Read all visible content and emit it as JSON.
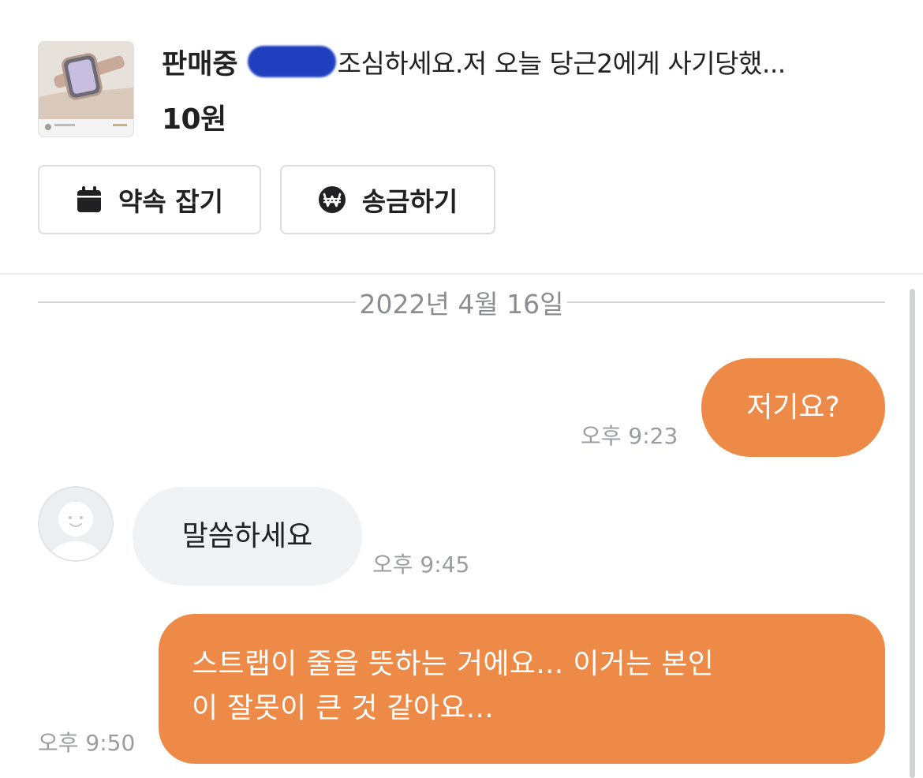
{
  "product": {
    "status": "판매중",
    "title": "조심하세요.저 오늘 당근2에게 사기당했...",
    "price": "10원",
    "thumbnail_icon": "watch-product-photo",
    "redaction_color": "#1f3fbf"
  },
  "actions": {
    "appointment": {
      "label": "약속 잡기",
      "icon": "calendar-icon"
    },
    "transfer": {
      "label": "송금하기",
      "icon": "won-coin-icon"
    }
  },
  "chat": {
    "date": "2022년 4월 16일",
    "messages": [
      {
        "direction": "outgoing",
        "text": "저기요?",
        "time": "오후 9:23"
      },
      {
        "direction": "incoming",
        "text": "말씀하세요",
        "time": "오후 9:45"
      },
      {
        "direction": "outgoing",
        "lines": [
          "스트랩이 줄을 뜻하는 거에요... 이거는 본인",
          "이 잘못이 큰 것 같아요..."
        ],
        "time": "오후 9:50"
      }
    ]
  },
  "colors": {
    "outgoing_bubble": "#ed8a48",
    "incoming_bubble": "#f1f2f5",
    "text": "#212124",
    "muted_text": "#9a9ca1"
  }
}
